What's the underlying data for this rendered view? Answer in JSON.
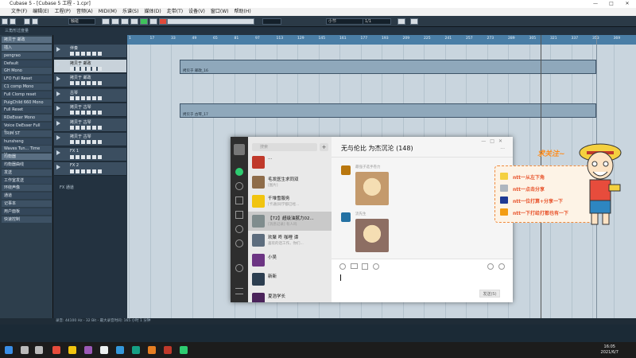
{
  "window": {
    "title": "Cubase 5 - [Cubase 5 工程 - 1.cpr]",
    "controls": [
      "—",
      "□",
      "✕"
    ]
  },
  "menu": [
    "文件(F)",
    "编辑(E)",
    "工程(P)",
    "音频(A)",
    "MIDI(M)",
    "乐谱(S)",
    "媒体(D)",
    "走带(T)",
    "设备(V)",
    "窗口(W)",
    "帮助(H)"
  ],
  "toolbar": {
    "touch_value": "触碰",
    "snap_value": "小节",
    "quantize_value": "1/1"
  },
  "subbar": {
    "label": "三角形过度量"
  },
  "inspector": {
    "header": "拷贝于 邮政",
    "rows": [
      {
        "label": "插入",
        "style": "hi"
      },
      {
        "label": "pengrao",
        "style": ""
      },
      {
        "label": "Default",
        "style": "alt"
      },
      {
        "label": "GH Mono",
        "style": ""
      },
      {
        "label": "LFO Full Reset",
        "style": "alt"
      },
      {
        "label": "C1 comp Mono",
        "style": ""
      },
      {
        "label": "Full Clomp reset",
        "style": "alt"
      },
      {
        "label": "PuigChild 660 Mono",
        "style": ""
      },
      {
        "label": "Full Reset",
        "style": "alt"
      },
      {
        "label": "RDeEsser Mono",
        "style": ""
      },
      {
        "label": "Voice DeEsser Full Reset",
        "style": "alt"
      },
      {
        "label": "TRIM ST",
        "style": ""
      },
      {
        "label": "hunsheng",
        "style": "alt"
      },
      {
        "label": "Waves Tun... Time Mono",
        "style": ""
      },
      {
        "label": "均衡器",
        "style": "hi"
      },
      {
        "label": "均衡器曲线",
        "style": "alt"
      },
      {
        "label": "发送",
        "style": ""
      },
      {
        "label": "工作室发送",
        "style": "alt"
      },
      {
        "label": "环绕声像",
        "style": ""
      },
      {
        "label": "通道",
        "style": "alt"
      },
      {
        "label": "记事本",
        "style": ""
      },
      {
        "label": "用户面板",
        "style": "alt"
      },
      {
        "label": "快速控制",
        "style": ""
      }
    ]
  },
  "tracks": [
    {
      "name": "伴奏",
      "selected": false
    },
    {
      "name": "拷贝于 邮政",
      "selected": true
    },
    {
      "name": "拷贝于 邮政",
      "selected": false
    },
    {
      "name": "古琴",
      "selected": false
    },
    {
      "name": "拷贝于 古琴",
      "selected": false
    },
    {
      "name": "拷贝于 古琴",
      "selected": false
    },
    {
      "name": "拷贝于 古琴",
      "selected": false
    },
    {
      "name": "FX 1",
      "selected": false
    },
    {
      "name": "FX 2",
      "selected": false
    }
  ],
  "tracklist_footer": "FX 通道",
  "arrange": {
    "ruler_ticks": [
      "1",
      "17",
      "33",
      "49",
      "65",
      "81",
      "97",
      "113",
      "129",
      "145",
      "161",
      "177",
      "193",
      "209",
      "225",
      "241",
      "257",
      "273",
      "289",
      "305",
      "321",
      "337",
      "353",
      "369"
    ],
    "parts": [
      {
        "label": "拷贝于 邮政_16"
      },
      {
        "label": "拷贝于 古琴_17"
      }
    ]
  },
  "status": {
    "text": "录音: 44100 Hz - 32 Bit - 最大录音时间: 165 小时 1 分钟"
  },
  "wechat": {
    "search_placeholder": "搜索",
    "add": "+",
    "chat_title": "无与伦比 为杰沉沦 (148)",
    "chats": [
      {
        "name": "...",
        "preview": "",
        "time": "",
        "color": "#c0392b"
      },
      {
        "name": "毛发医生求同双",
        "preview": "[图片]",
        "time": "",
        "color": "#8e6c4a"
      },
      {
        "name": "千堆雪服务",
        "preview": "[卡通]同学都已经...",
        "time": "",
        "color": "#f1c40f"
      },
      {
        "name": "【72】超级油腻力02...",
        "preview": "[消息记录] 有人吗",
        "time": "",
        "color": "#7f8c8d"
      },
      {
        "name": "欢聚 咚 咖哩 谭",
        "preview": "喜欢的话工作，你们...",
        "time": "",
        "color": "#5d6d7e"
      },
      {
        "name": "小吴",
        "preview": "",
        "time": "",
        "color": "#6c3483"
      },
      {
        "name": "新新",
        "preview": "",
        "time": "",
        "color": "#2c3e50"
      },
      {
        "name": "夏浩学长",
        "preview": "",
        "time": "",
        "color": "#4a235a"
      }
    ],
    "messages": [
      {
        "sender": "最强子选手卷力",
        "color": "#b9770e"
      },
      {
        "sender": "流先生",
        "color": "#2471a3"
      }
    ],
    "send_label": "发送(S)"
  },
  "overlay": {
    "title": "求关注~",
    "items": [
      {
        "text": "ntt一从左下角",
        "icon_color": "#f4d03f"
      },
      {
        "text": "ntt一点击分享",
        "icon_color": "#aeb6bf"
      },
      {
        "text": "ntt一位打算+分享一下",
        "icon_color": "#1f3a93"
      },
      {
        "text": "ntt一下打给打都也有一下",
        "icon_color": "#f39c12"
      }
    ]
  },
  "taskbar": {
    "time": "16:05",
    "date": "2021/6/7",
    "apps": [
      {
        "name": "windows-icon",
        "color": "#3a8ee6"
      },
      {
        "name": "search-icon",
        "color": "#bbbbbb"
      },
      {
        "name": "taskview-icon",
        "color": "#bbbbbb"
      },
      {
        "name": "chrome-icon",
        "color": "#e74c3c"
      },
      {
        "name": "folder-icon",
        "color": "#f1c40f"
      },
      {
        "name": "store-icon",
        "color": "#9b59b6"
      },
      {
        "name": "app1-icon",
        "color": "#ecf0f1"
      },
      {
        "name": "app2-icon",
        "color": "#3498db"
      },
      {
        "name": "app3-icon",
        "color": "#16a085"
      },
      {
        "name": "app4-icon",
        "color": "#e67e22"
      },
      {
        "name": "cubase-icon",
        "color": "#c0392b"
      },
      {
        "name": "wechat-icon",
        "color": "#2ecc71"
      }
    ]
  }
}
